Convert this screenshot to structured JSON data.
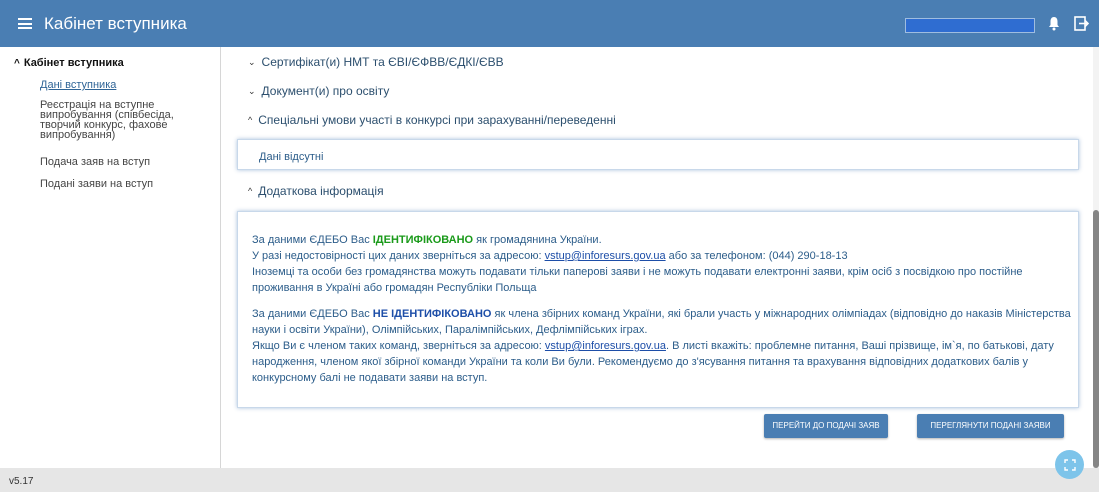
{
  "header": {
    "title": "Кабінет вступника"
  },
  "sidebar": {
    "section_title": "Кабінет вступника",
    "items": [
      {
        "label": "Дані вступника",
        "active": true
      },
      {
        "label": "Реєстрація на вступне випробування (співбесіда, творчий конкурс, фахове випробування)"
      },
      {
        "label": "Подача заяв на вступ"
      },
      {
        "label": "Подані заяви на вступ"
      }
    ]
  },
  "main": {
    "sections": [
      {
        "label": "Сертифікат(и) НМТ та ЄВІ/ЄФВВ/ЄДКІ/ЄВВ",
        "expanded": false
      },
      {
        "label": "Документ(и) про освіту",
        "expanded": false
      },
      {
        "label": "Спеціальні умови участі в конкурсі при зарахуванні/переведенні",
        "expanded": true
      },
      {
        "label": "Додаткова інформація",
        "expanded": true
      }
    ],
    "special_conditions_empty": "Дані відсутні",
    "info": {
      "p1_a": "За даними ЄДЕБО Вас ",
      "p1_status": "ІДЕНТИФІКОВАНО",
      "p1_b": " як громадянина України.",
      "p1_c": "У разі недостовірності цих даних зверніться за адресою: ",
      "email": "vstup@inforesurs.gov.ua",
      "p1_d": " або за телефоном: (044) 290-18-13",
      "p1_e": "Іноземці та особи без громадянства можуть подавати тільки паперові заяви і не можуть подавати електронні заяви, крім осіб з посвідкою про постійне проживання в Україні або громадян Республіки Польща",
      "p2_a": "За даними ЄДЕБО Вас ",
      "p2_status": "НЕ ІДЕНТИФІКОВАНО",
      "p2_b": " як члена збірних команд України, які брали участь у міжнародних олімпіадах (відповідно до наказів Міністерства науки і освіти України), Олімпійських, Паралімпійських, Дефлімпійських іграх.",
      "p2_c": "Якщо Ви є членом таких команд, зверніться за адресою: ",
      "p2_d": ". В листі вкажіть: проблемне питання, Ваші прізвище, ім`я, по батькові, дату народження, членом якої збірної команди України та коли Ви були. Рекомендуємо до з'ясування питання та врахування відповідних додаткових балів у конкурсному балі не подавати заяви на вступ."
    },
    "buttons": {
      "submit": "ПЕРЕЙТИ ДО ПОДАЧІ ЗАЯВ",
      "view": "ПЕРЕГЛЯНУТИ ПОДАНІ ЗАЯВИ"
    }
  },
  "footer": {
    "version": "v5.17"
  },
  "icons": {
    "menu": "hamburger-icon",
    "notifications": "bell-icon",
    "logout": "logout-icon",
    "fab": "expand-icon"
  },
  "colors": {
    "header_bg": "#4a7eb3",
    "button_bg": "#4a7eb3",
    "identified": "#1a9a1a",
    "not_identified": "#1d4ea8",
    "text_blue": "#2c5d8a"
  }
}
